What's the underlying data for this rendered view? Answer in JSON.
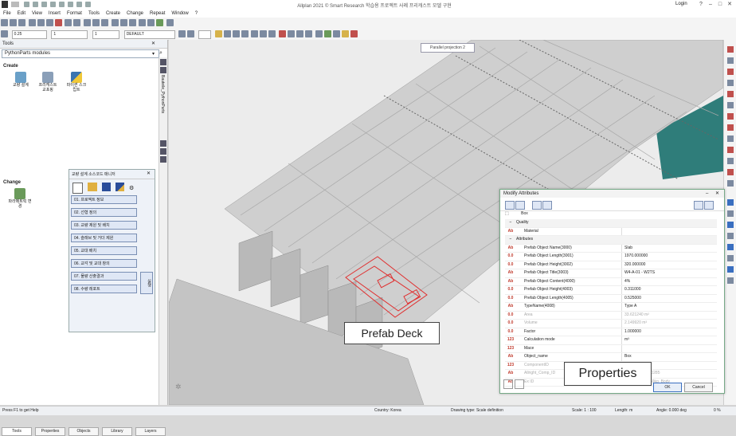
{
  "title_bar": {
    "app_title": "Allplan 2021   © Smart Research   학습용 프로젝트 사례 프리캐스트 모델 구현",
    "login": "Login"
  },
  "menu": [
    "File",
    "Edit",
    "View",
    "Insert",
    "Format",
    "Tools",
    "Create",
    "Change",
    "Repeat",
    "Window",
    "?"
  ],
  "toolbar": {
    "pen_value": "0.25",
    "line_value": "1",
    "color_value": "1",
    "layer_value": "DEFAULT"
  },
  "left_panel": {
    "header": "Tools",
    "module": "PythonParts modules",
    "create_label": "Create",
    "create_items": [
      {
        "label": "교량 설계",
        "icon": "bridge-design-icon"
      },
      {
        "label": "프리캐스트 교포핑",
        "icon": "precast-icon"
      },
      {
        "label": "파이썬 스크립트",
        "icon": "python-icon"
      }
    ],
    "change_label": "Change",
    "change_items": [
      {
        "label": "파라메트릭 변경",
        "icon": "modify-icon"
      }
    ],
    "tabs": [
      "Tools",
      "Properties",
      "Objects",
      "Library",
      "Layers"
    ]
  },
  "floating_menu": {
    "title": "교량 설계 소스코드 매니저",
    "items": [
      "01. 프로젝트 정보",
      "02. 선형 정의",
      "03. 교량 제원 및 배치",
      "04. 슬래브 및 거더 제원",
      "05. 교대 배치",
      "06. 교각 및 교대 창의",
      "07. 물량 산출결과",
      "08. 수량 레포트"
    ],
    "side_button": "실행"
  },
  "viewport": {
    "title": "Parallel projection 2",
    "callout_deck": "Prefab Deck",
    "callout_props": "Properties"
  },
  "dialog": {
    "title": "Modify Attributes",
    "object_type": "Box",
    "rows": [
      {
        "type": "section",
        "name": "Quality",
        "value": ""
      },
      {
        "type": "attr",
        "icon": "Ab",
        "name": "Material",
        "value": ""
      },
      {
        "type": "section",
        "name": "Attributes",
        "value": ""
      },
      {
        "type": "attr",
        "icon": "Ab",
        "name": "Prefab Object Name(3000)",
        "value": "Slab"
      },
      {
        "type": "attr",
        "icon": "0.0",
        "name": "Prefab Object Length(3001)",
        "value": "1970.000000"
      },
      {
        "type": "attr",
        "icon": "0.0",
        "name": "Prefab Object Height(3002)",
        "value": "320.000000"
      },
      {
        "type": "attr",
        "icon": "Ab",
        "name": "Prefab Object Title(3003)",
        "value": "W4-A-01 - W2TS"
      },
      {
        "type": "attr",
        "icon": "Ab",
        "name": "Prefab Object Content(4000)",
        "value": "4%"
      },
      {
        "type": "attr",
        "icon": "0.0",
        "name": "Prefab Object Height(4003)",
        "value": "0.311000"
      },
      {
        "type": "attr",
        "icon": "0.0",
        "name": "Prefab Object Length(4005)",
        "value": "0.525000"
      },
      {
        "type": "attr",
        "icon": "Ab",
        "name": "TypeName(4008)",
        "value": "Type A"
      },
      {
        "type": "grey",
        "icon": "0.0",
        "name": "Area",
        "value": "33.621240 m²"
      },
      {
        "type": "grey",
        "icon": "0.0",
        "name": "Volume",
        "value": "2.149920 m³"
      },
      {
        "type": "attr",
        "icon": "0.0",
        "name": "Factor",
        "value": "1.000000"
      },
      {
        "type": "attr",
        "icon": "123",
        "name": "Calculation mode",
        "value": "m³"
      },
      {
        "type": "attr",
        "icon": "123",
        "name": "Mace",
        "value": ""
      },
      {
        "type": "attr",
        "icon": "Ab",
        "name": "Object_name",
        "value": "Box"
      },
      {
        "type": "grey",
        "icon": "123",
        "name": "ComponentID",
        "value": "-1097"
      },
      {
        "type": "grey",
        "icon": "Ab",
        "name": "Allright_Comp_ID",
        "value": "1b9b4b5200000285"
      },
      {
        "type": "grey",
        "icon": "Ab",
        "name": "Ex ID",
        "value": "6dd4d39f0a0469kg_Body"
      }
    ],
    "ok": "OK",
    "cancel": "Cancel"
  },
  "status_bar": {
    "left": "Press F1 to get Help",
    "country": "Country:  Korea",
    "drawing_type": "Drawing type:  Scale definition",
    "scale": "Scale:  1 : 100",
    "length": "Length:  m",
    "angle": "Angle:  0.000  deg",
    "pct": "0 %"
  },
  "colors": {
    "accent": "#3a6fc0",
    "deck_highlight": "#e03030",
    "teal": "#2f7d7a"
  }
}
